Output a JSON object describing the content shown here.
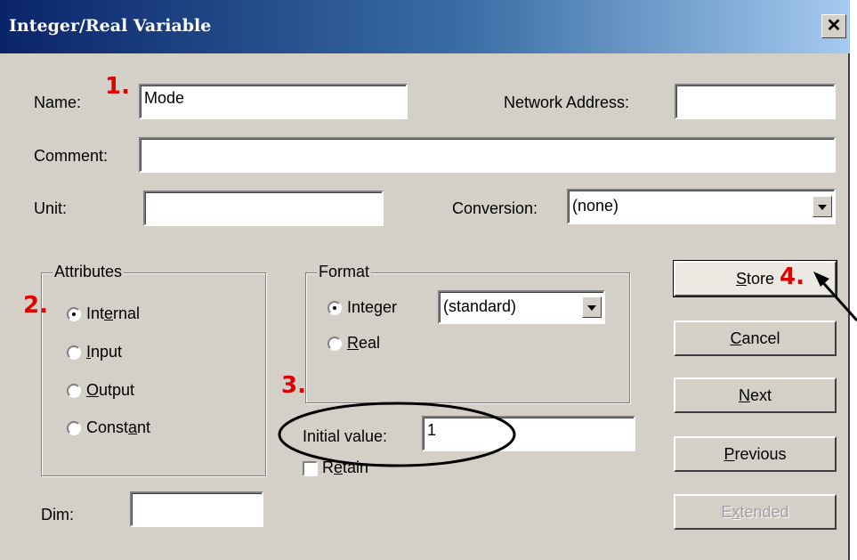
{
  "dialog": {
    "title": "Integer/Real Variable"
  },
  "fields": {
    "name_label": "Name:",
    "name_value": "Mode",
    "network_label": "Network Address:",
    "network_value": "",
    "comment_label": "Comment:",
    "comment_value": "",
    "unit_label": "Unit:",
    "unit_value": "",
    "conversion_label": "Conversion:",
    "conversion_value": "(none)",
    "dim_label": "Dim:",
    "dim_value": ""
  },
  "attributes": {
    "title": "Attributes",
    "options": [
      "Internal",
      "Input",
      "Output",
      "Constant"
    ],
    "selected": "Internal"
  },
  "format": {
    "title": "Format",
    "options": [
      "Integer",
      "Real"
    ],
    "selected": "Integer",
    "type_value": "(standard)",
    "initial_label": "Initial value:",
    "initial_value": "1",
    "retain_label": "Retain",
    "retain_checked": false
  },
  "buttons": {
    "store": "Store",
    "cancel": "Cancel",
    "next": "Next",
    "previous": "Previous",
    "extended": "Extended"
  },
  "annotations": {
    "a1": "1.",
    "a2": "2.",
    "a3": "3.",
    "a4": "4.",
    "color": "#e00000"
  }
}
